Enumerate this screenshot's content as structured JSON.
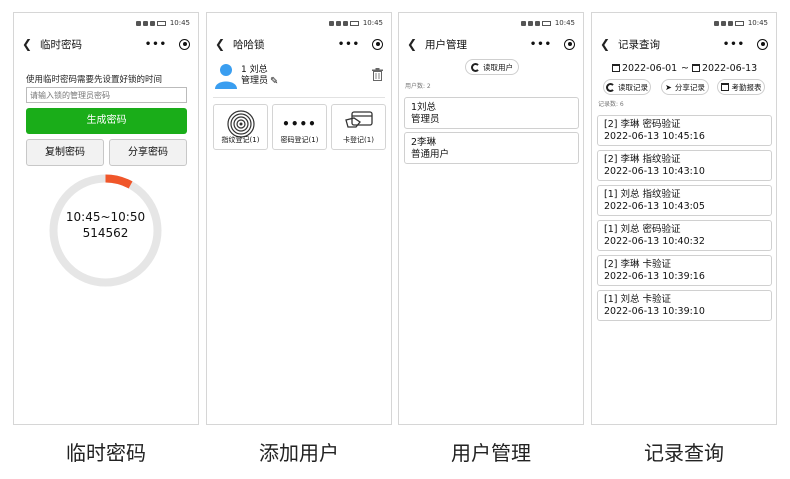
{
  "status": {
    "time": "10:45"
  },
  "screens": {
    "temp_password": {
      "title": "临时密码",
      "tip": "使用临时密码需要先设置好锁的时间",
      "placeholder": "请输入锁的管理员密码",
      "generate": "生成密码",
      "copy": "复制密码",
      "share": "分享密码",
      "time_range": "10:45~10:50",
      "code": "514562",
      "ring_progress": 0.08,
      "ring_color": "#f0562a",
      "caption": "临时密码"
    },
    "add_user": {
      "title": "哈哈锁",
      "user_name": "1 刘总",
      "user_role": "管理员",
      "cards": [
        {
          "label": "指纹登记(1)",
          "icon": "fingerprint-icon"
        },
        {
          "label": "密码登记(1)",
          "icon": "password-dots-icon"
        },
        {
          "label": "卡登记(1)",
          "icon": "card-icon"
        }
      ],
      "caption": "添加用户"
    },
    "user_manage": {
      "title": "用户管理",
      "read_button": "读取用户",
      "count": "用户数: 2",
      "users": [
        {
          "line1": "1刘总",
          "line2": "管理员"
        },
        {
          "line1": "2李琳",
          "line2": "普通用户"
        }
      ],
      "caption": "用户管理"
    },
    "records": {
      "title": "记录查询",
      "date_from": "2022-06-01",
      "date_sep": "~",
      "date_to": "2022-06-13",
      "btn_read": "读取记录",
      "btn_share": "分享记录",
      "btn_report": "考勤报表",
      "count": "记录数: 6",
      "items": [
        {
          "line1": "[2] 李琳 密码验证",
          "line2": "2022-06-13 10:45:16"
        },
        {
          "line1": "[2] 李琳 指纹验证",
          "line2": "2022-06-13 10:43:10"
        },
        {
          "line1": "[1] 刘总 指纹验证",
          "line2": "2022-06-13 10:43:05"
        },
        {
          "line1": "[1] 刘总 密码验证",
          "line2": "2022-06-13 10:40:32"
        },
        {
          "line1": "[2] 李琳 卡验证",
          "line2": "2022-06-13 10:39:16"
        },
        {
          "line1": "[1] 刘总 卡验证",
          "line2": "2022-06-13 10:39:10"
        }
      ],
      "caption": "记录查询"
    }
  },
  "colors": {
    "accent_green": "#1aad19",
    "avatar_blue": "#3a9ef0"
  }
}
